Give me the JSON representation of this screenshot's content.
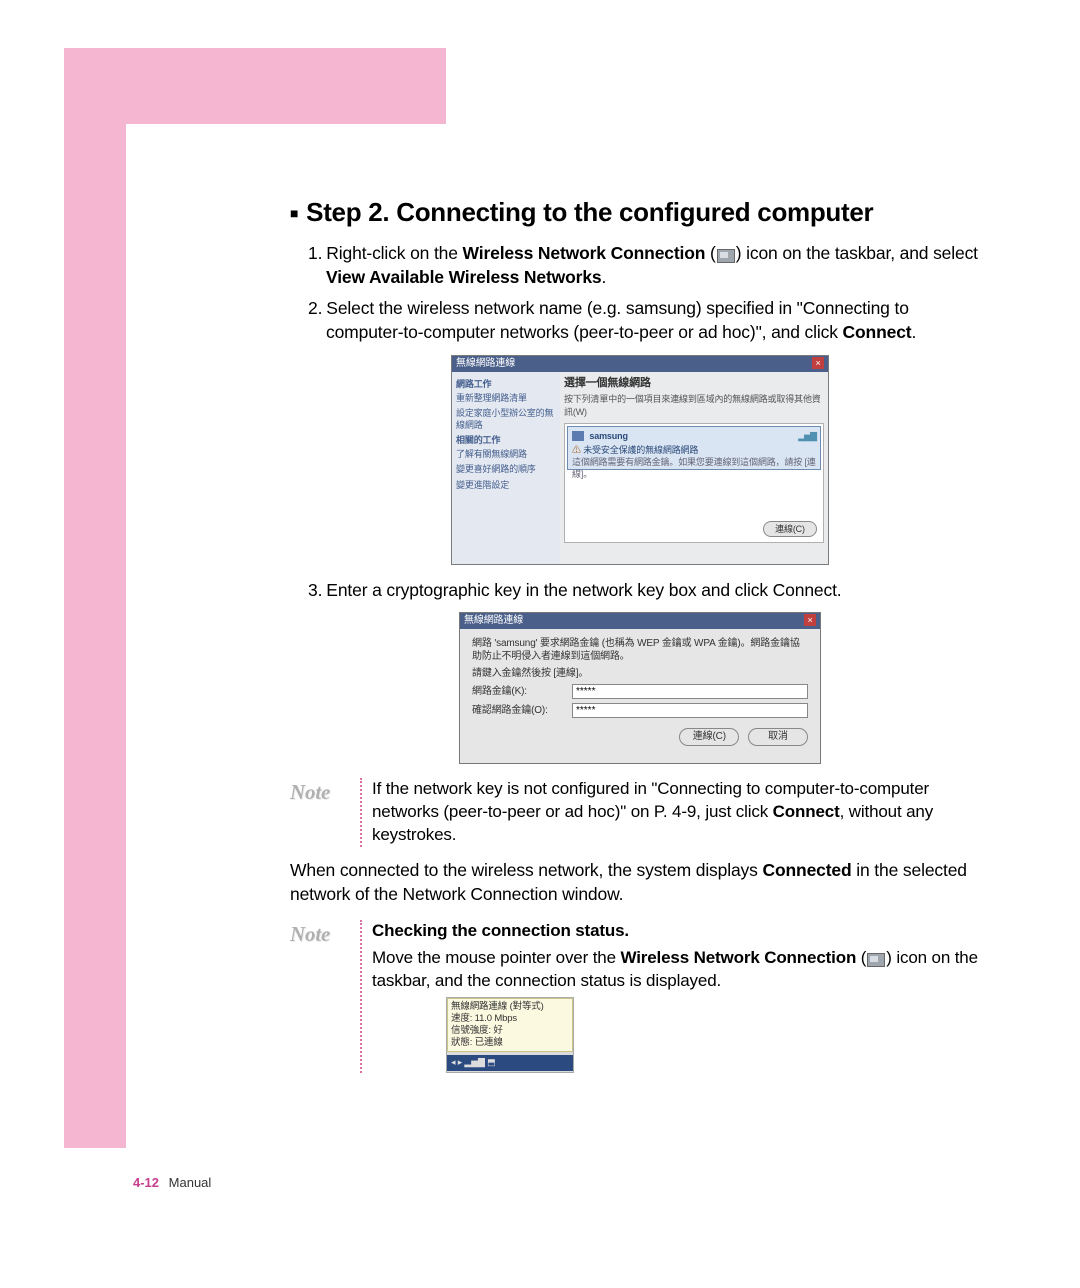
{
  "header": {
    "step_title": "Step 2. Connecting to the configured computer"
  },
  "steps": {
    "s1_a": "Right-click on the ",
    "s1_b": "Wireless Network Connection",
    "s1_c": " icon on the taskbar, and select ",
    "s1_d": "View Available Wireless Networks",
    "s1_e": ".",
    "s2_a": "Select the wireless network name (e.g. samsung) specified in \"Connecting to computer-to-computer networks (peer-to-peer or ad hoc)\", and click ",
    "s2_b": "Connect",
    "s2_c": ".",
    "s3": "Enter a cryptographic key in the network key box and click Connect."
  },
  "dlg1": {
    "title": "無線網路連線",
    "side_hd1": "網路工作",
    "side_i1": "重新整理網路清單",
    "side_i2": "設定家庭小型辦公室的無線網路",
    "side_hd2": "相關的工作",
    "side_i3": "了解有關無線網路",
    "side_i4": "變更喜好網路的順序",
    "side_i5": "變更進階設定",
    "main_hd": "選擇一個無線網路",
    "main_sub": "按下列清單中的一個項目來連線到區域內的無線網路或取得其他資訊(W)",
    "net_name": "samsung",
    "net_note1": "未受安全保護的無線網路網路",
    "net_note2": "這個網路需要有網路金鑰。如果您要連線到這個網路，請按 [連線]。",
    "signal": "▂▅▇",
    "connect_btn": "連線(C)"
  },
  "dlg2": {
    "title": "無線網路連線",
    "msg1": "網路 'samsung' 要求網路金鑰 (也稱為 WEP 金鑰或 WPA 金鑰)。網路金鑰協助防止不明侵入者連線到這個網路。",
    "msg2": "請鍵入金鑰然後按 [連線]。",
    "lbl_key": "網路金鑰(K):",
    "lbl_conf": "確認網路金鑰(O):",
    "val_key": "*****",
    "val_conf": "*****",
    "btn_connect": "連線(C)",
    "btn_cancel": "取消"
  },
  "note1": {
    "label": "Note",
    "text_a": "If the network key is not configured in \"Connecting to computer-to-computer networks (peer-to-peer or ad hoc)\" on P. 4-9, just click ",
    "text_b": "Connect",
    "text_c": ", without any keystrokes."
  },
  "para": {
    "a": "When connected to the wireless network, the system displays ",
    "b": "Connected",
    "c": " in the selected network of the Network Connection window."
  },
  "note2": {
    "label": "Note",
    "subtitle": "Checking the connection status.",
    "text_a": "Move the mouse pointer over the ",
    "text_b": "Wireless Network Connection",
    "text_c": " icon on the taskbar, and the connection status is displayed."
  },
  "tooltip": {
    "l1": "無線網路連線 (對等式)",
    "l2": "速度: 11.0 Mbps",
    "l3": "信號強度: 好",
    "l4": "狀態: 已連線"
  },
  "footer": {
    "page": "4-12",
    "label": "Manual"
  }
}
